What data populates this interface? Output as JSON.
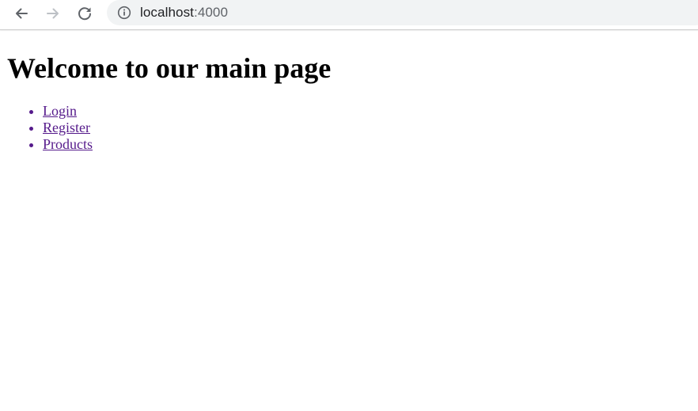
{
  "browser": {
    "url_host": "localhost",
    "url_port": ":4000",
    "icons": {
      "back": "arrow-left-icon",
      "forward": "arrow-right-icon",
      "reload": "reload-icon",
      "site_info": "info-icon"
    },
    "colors": {
      "icon_active": "#5f6368",
      "icon_disabled": "#bdc1c6",
      "omnibox_bg": "#f1f3f4"
    }
  },
  "page": {
    "title": "Welcome to our main page",
    "links": [
      {
        "label": "Login"
      },
      {
        "label": "Register"
      },
      {
        "label": "Products"
      }
    ],
    "colors": {
      "visited_link": "#551a8b"
    }
  }
}
